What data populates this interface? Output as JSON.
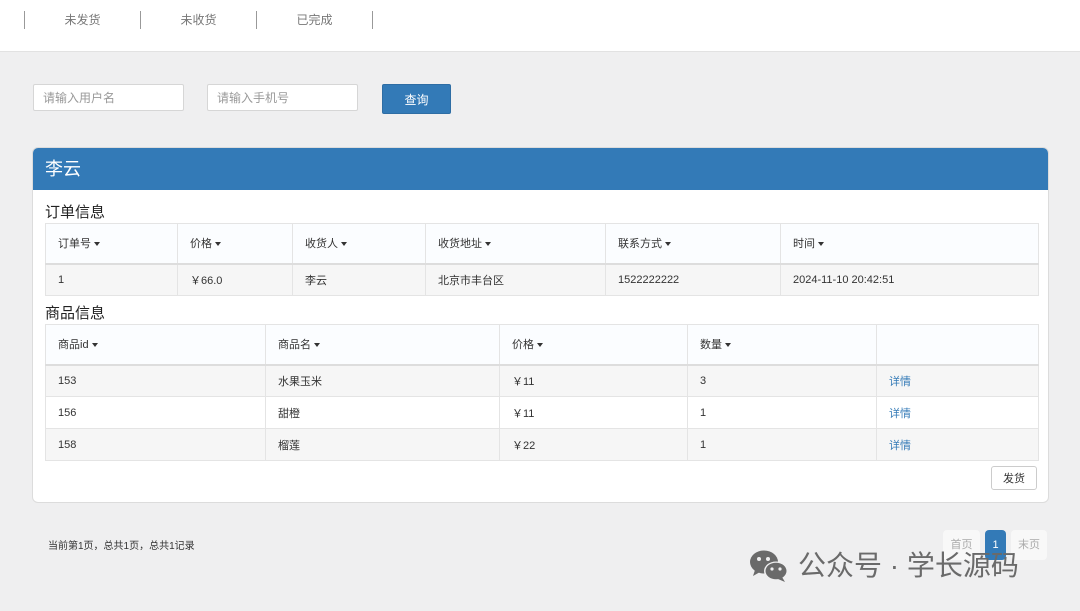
{
  "tabs": [
    "未发货",
    "未收货",
    "已完成"
  ],
  "search": {
    "username_placeholder": "请输入用户名",
    "phone_placeholder": "请输入手机号",
    "query_label": "查询"
  },
  "panel": {
    "title": "李云",
    "order_section_title": "订单信息",
    "order_columns": [
      "订单号",
      "价格",
      "收货人",
      "收货地址",
      "联系方式",
      "时间"
    ],
    "order_rows": [
      [
        "1",
        "￥66.0",
        "李云",
        "北京市丰台区",
        "1522222222",
        "2024-11-10 20:42:51"
      ]
    ],
    "goods_section_title": "商品信息",
    "goods_columns": [
      "商品id",
      "商品名",
      "价格",
      "数量",
      ""
    ],
    "goods_rows": [
      [
        "153",
        "水果玉米",
        "￥11",
        "3",
        "详情"
      ],
      [
        "156",
        "甜橙",
        "￥11",
        "1",
        "详情"
      ],
      [
        "158",
        "榴莲",
        "￥22",
        "1",
        "详情"
      ]
    ],
    "ship_label": "发货"
  },
  "pagination": {
    "info": "当前第1页，总共1页，总共1记录",
    "first": "首页",
    "current": "1",
    "last": "末页"
  },
  "watermark": {
    "text": "公众号 · 学长源码",
    "icon": "wechat-icon"
  },
  "colors": {
    "primary": "#337ab7",
    "background": "#efeff0"
  }
}
